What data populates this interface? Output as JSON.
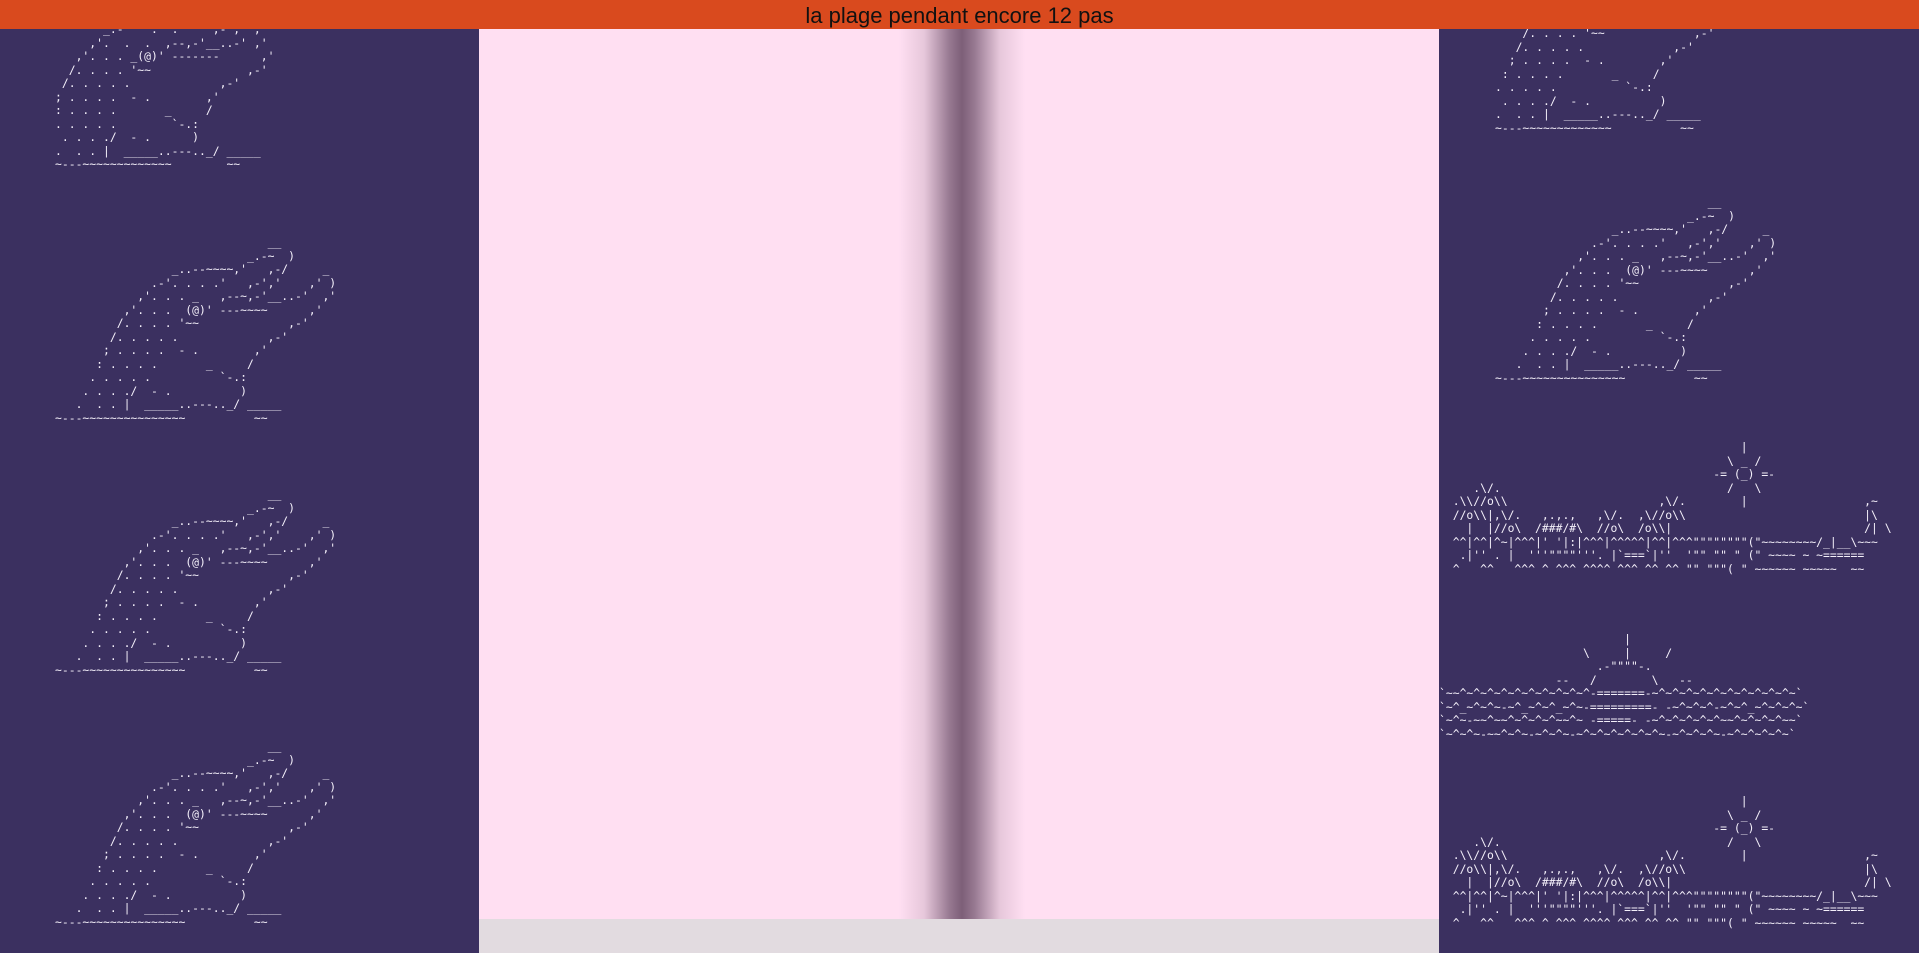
{
  "header": {
    "title": "la plage pendant encore 12 pas"
  },
  "ascii": {
    "dolphin_cut": "       _.-'   .  .  '  ,-',' ,'\n     ,'.  .  .  ,--,-'__..-' ,'\n   ,'. . . _(@)' -------      ,'\n  /. . . . '~~              ,-'\n /. . . . .             ,-'\n; . . . .  - .        ,'\n: . . . .       _     /\n. . . . .        `-.:\n . . . ./  - .      )\n.  . . |  _____..---.._/ _____\n~---~~~~~~~~~~~~~        ~~",
    "dolphin": "                               __\n                            _.-~  )\n                 _..--~~~~,'   ,-/     _\n              .-'. . . .'   ,-','    ,' )\n            ,'. . . _   ,--~,-'__..-'  ,'\n          ,'. . .  (@)' ---~~~~      ,'\n         /. . . . '~~             ,-'\n        /. . . . .             ,-'\n       ; . . . .  - .        ,'\n      : . . . .       _     /\n     . . . . .          `-.:\n    . . . ./  - .          )\n   .  . . |  _____..---.._/ _____\n~---~~~~~~~~~~~~~~~          ~~",
    "dolphin_top_right": "    /. . . . '~~             ,-'\n   /. . . . .             ,-'\n  ; . . . .  - .        ,'\n : . . . .       _     /\n. . . . .          `-.:\n . . . ./  - .          )\n.  . . |  _____..---.._/ _____\n~---~~~~~~~~~~~~~          ~~",
    "beach": "                                            |\n                                          \\ _ /\n                                        -= (_) =-\n     .\\/.                                 /   \\\n  .\\\\//o\\\\                      ,\\/.        |                 ,~\n  //o\\\\|,\\/.   ,.,.,   ,\\/.  ,\\//o\\\\                          |\\\n    |  |//o\\  /###/#\\  //o\\  /o\\\\|                            /| \\\n  ^^|^^|^~|^^^|' '|:|^^^|^^^^^|^^|^^^\"\"\"\"\"\"\"\"(\"~~~~~~~~/_|__\\~~~\n   .|'' . |  '''\"\"\"\"'''. |`===`|''  '\"\" \"\" \" (\" ~~~~ ~ ~======\n  ^   ^^   ^^^ ^ ^^^ ^^^^ ^^^ ^^ ^^ \"\" \"\"\"( \" ~~~~~~ ~~~~~  ~~",
    "sunset": "                           |\n                     \\     |     /\n                       .-\"\"\"\"-.\n                 --   /        \\   --\n`~~^~^~^~^~^~^~^~^~^~^-=======-~^~^~^~^~^~^~^~^~^~^~`\n`~^_~^~^~-~^_~^~^_~^~-=========- -~^~^~^-~^~^_~^~^~^~`\n`~^~-~~^~~^~^~^~^~~^~ -=====- -~^~^~^~^~^~~^~^~^~^~~`\n`~^~^~-~~^~^~-~^~^~-~^~^~^~^~^~^~-~^~^~^~-~^~^~^~^~`"
  }
}
